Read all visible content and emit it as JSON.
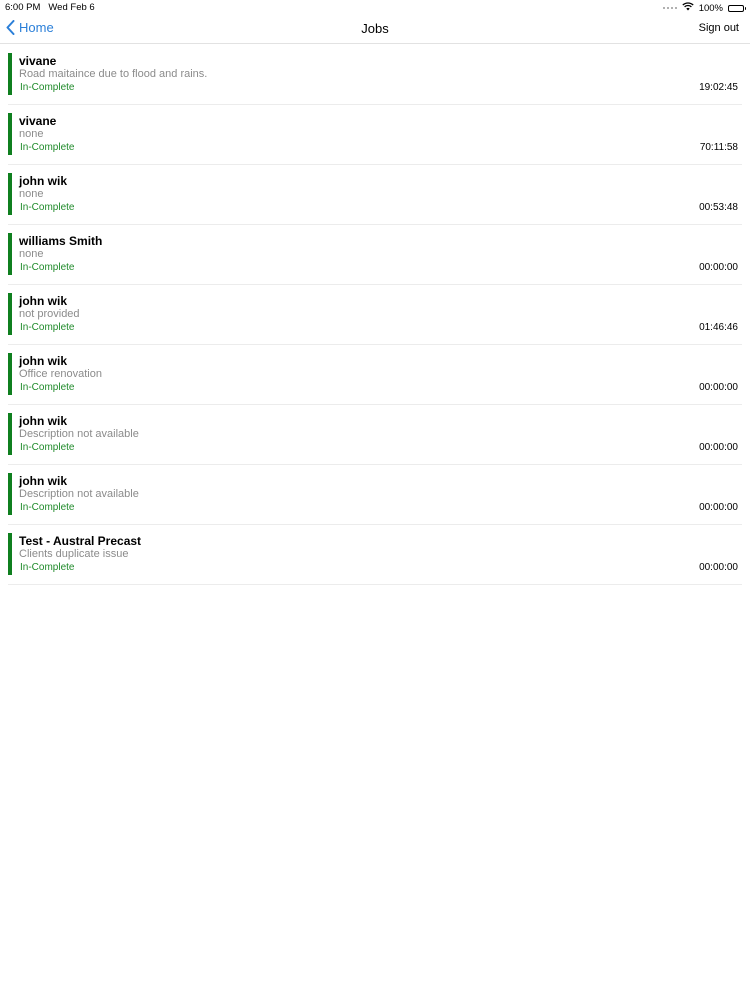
{
  "status_bar": {
    "time": "6:00 PM",
    "date": "Wed Feb 6",
    "battery": "100%"
  },
  "nav": {
    "back_label": "Home",
    "title": "Jobs",
    "sign_out": "Sign out"
  },
  "colors": {
    "accent_blue": "#2b7fd8",
    "status_green": "#1f8a2a",
    "bar_green": "#0f7f1f"
  },
  "jobs": [
    {
      "name": "vivane",
      "description": "Road maitaince due to flood and rains.",
      "status": "In-Complete",
      "time": "19:02:45"
    },
    {
      "name": "vivane",
      "description": "none",
      "status": "In-Complete",
      "time": "70:11:58"
    },
    {
      "name": "john wik",
      "description": "none",
      "status": "In-Complete",
      "time": "00:53:48"
    },
    {
      "name": "williams Smith",
      "description": "none",
      "status": "In-Complete",
      "time": "00:00:00"
    },
    {
      "name": "john wik",
      "description": "not provided",
      "status": "In-Complete",
      "time": "01:46:46"
    },
    {
      "name": "john wik",
      "description": "Office renovation",
      "status": "In-Complete",
      "time": "00:00:00"
    },
    {
      "name": "john wik",
      "description": "Description not available",
      "status": "In-Complete",
      "time": "00:00:00"
    },
    {
      "name": "john wik",
      "description": "Description not available",
      "status": "In-Complete",
      "time": "00:00:00"
    },
    {
      "name": "Test - Austral Precast",
      "description": "Clients duplicate issue",
      "status": "In-Complete",
      "time": "00:00:00"
    }
  ]
}
